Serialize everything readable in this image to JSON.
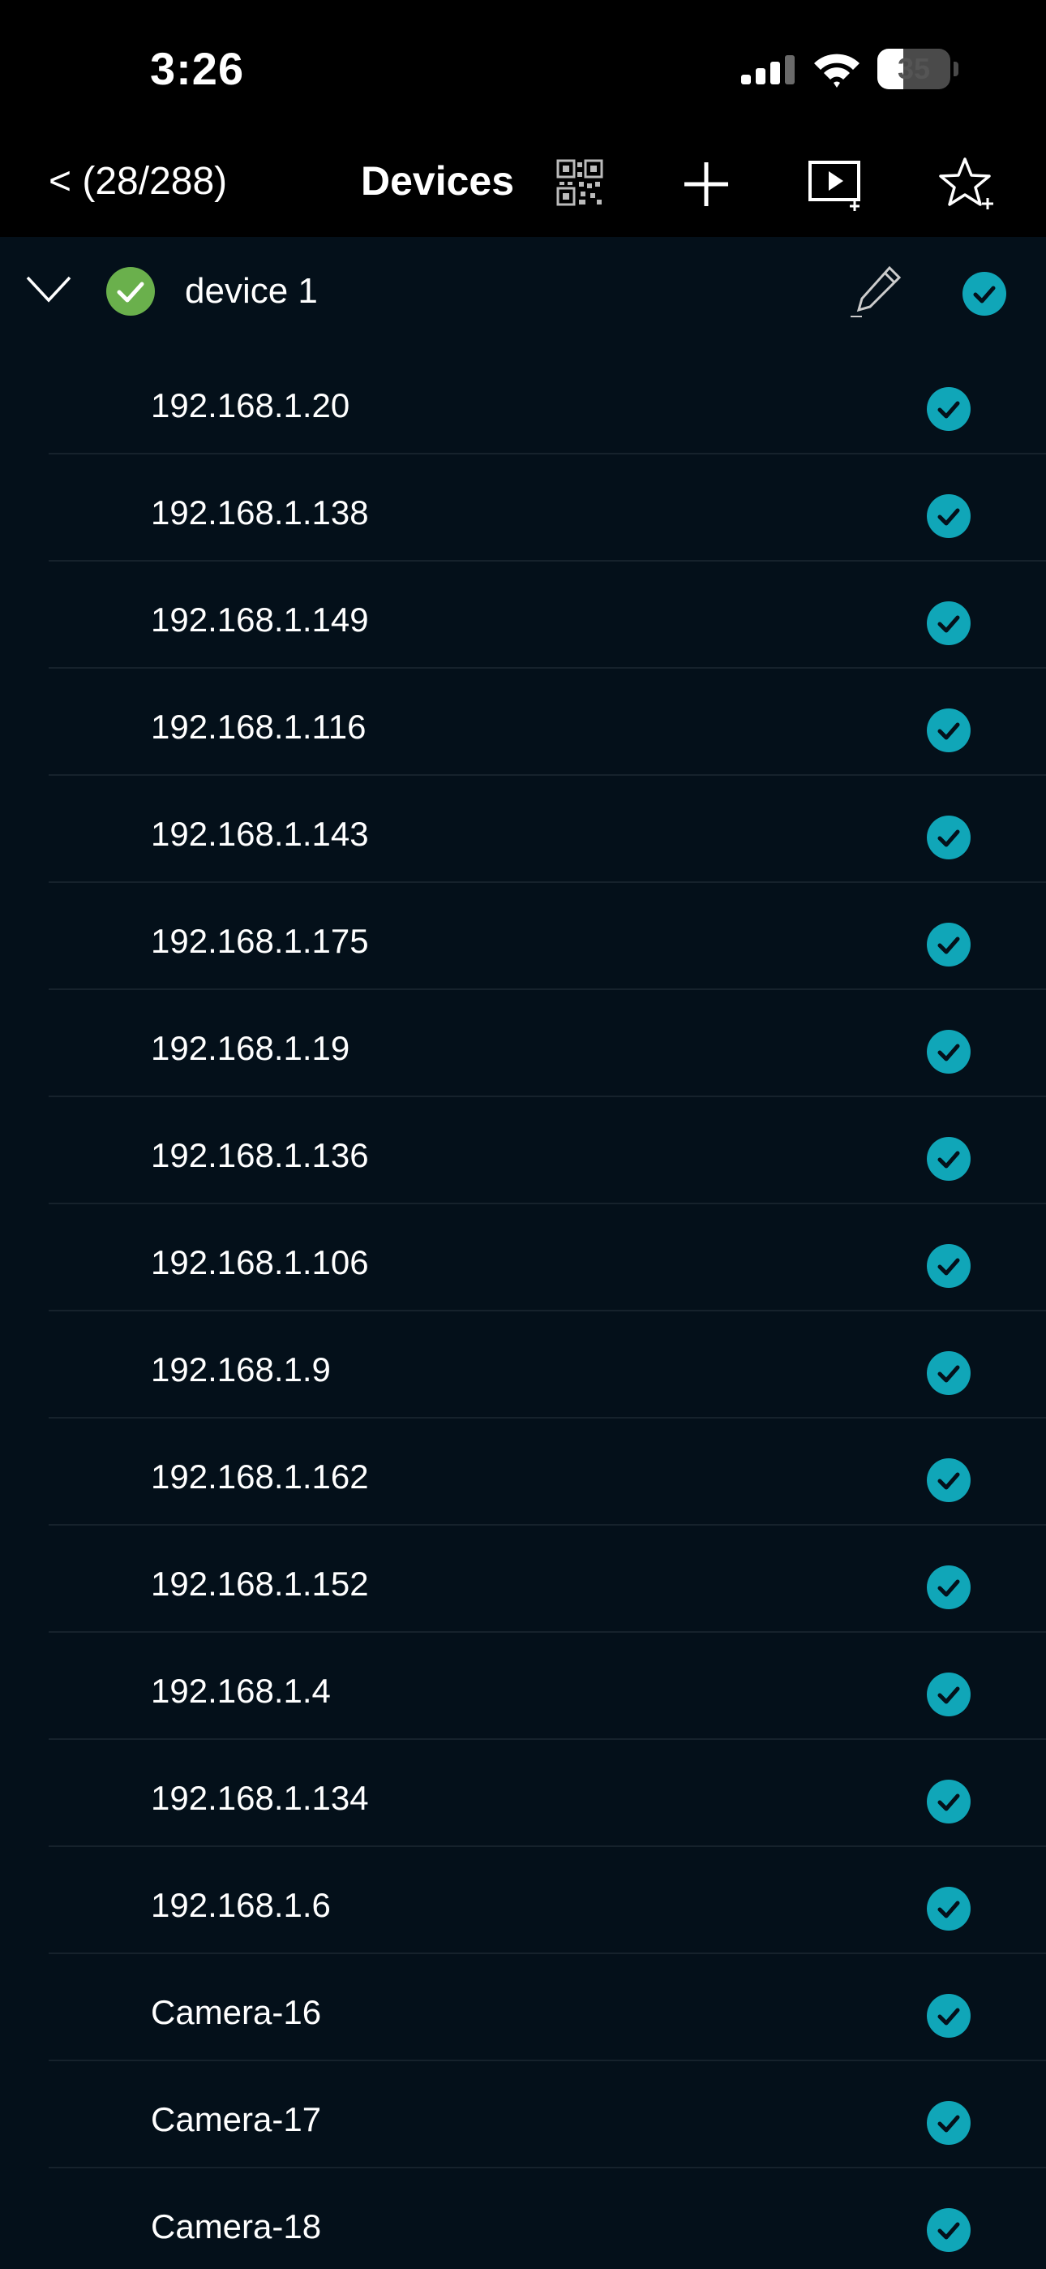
{
  "status_bar": {
    "time": "3:26",
    "battery": "35",
    "battery_level": 0.35
  },
  "nav": {
    "back_label": "< (28/288)",
    "title": "Devices"
  },
  "group": {
    "name": "device 1",
    "expanded": true,
    "status": "online",
    "selected": true
  },
  "devices": [
    {
      "name": "192.168.1.20",
      "selected": true
    },
    {
      "name": "192.168.1.138",
      "selected": true
    },
    {
      "name": "192.168.1.149",
      "selected": true
    },
    {
      "name": "192.168.1.116",
      "selected": true
    },
    {
      "name": "192.168.1.143",
      "selected": true
    },
    {
      "name": "192.168.1.175",
      "selected": true
    },
    {
      "name": "192.168.1.19",
      "selected": true
    },
    {
      "name": "192.168.1.136",
      "selected": true
    },
    {
      "name": "192.168.1.106",
      "selected": true
    },
    {
      "name": "192.168.1.9",
      "selected": true
    },
    {
      "name": "192.168.1.162",
      "selected": true
    },
    {
      "name": "192.168.1.152",
      "selected": true
    },
    {
      "name": "192.168.1.4",
      "selected": true
    },
    {
      "name": "192.168.1.134",
      "selected": true
    },
    {
      "name": "192.168.1.6",
      "selected": true
    },
    {
      "name": "Camera-16",
      "selected": true
    },
    {
      "name": "Camera-17",
      "selected": true
    },
    {
      "name": "Camera-18",
      "selected": true
    }
  ],
  "colors": {
    "background": "#04101a",
    "bar_background": "#000000",
    "accent_teal": "#10a6b8",
    "online_green": "#6ab04c",
    "divider": "#16222c"
  }
}
